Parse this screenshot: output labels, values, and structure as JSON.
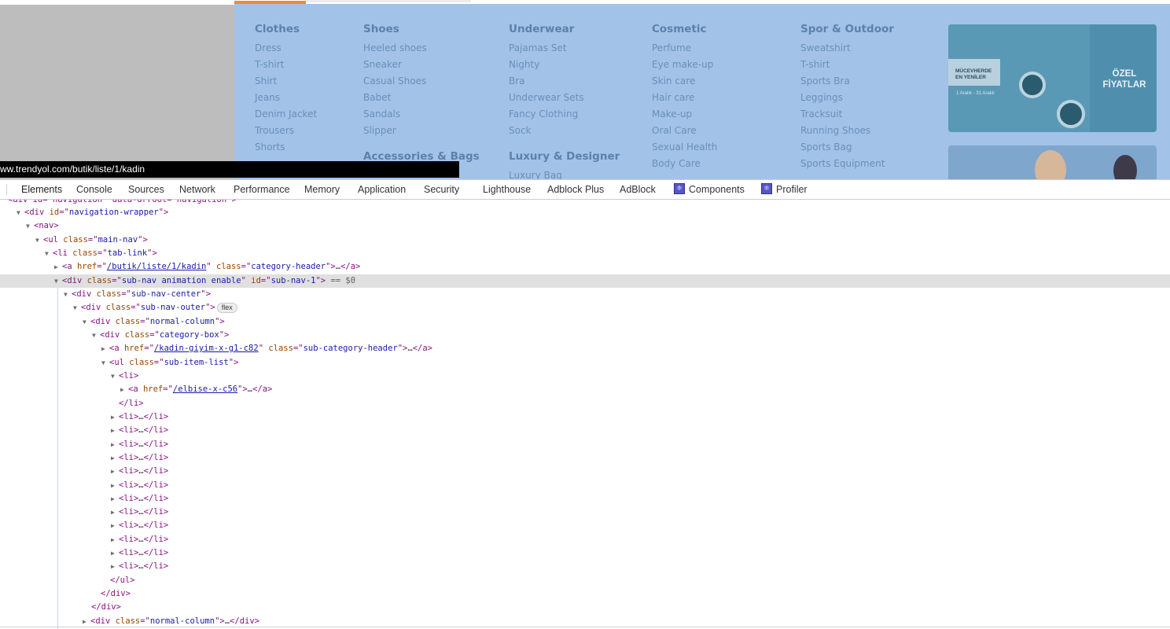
{
  "menu": {
    "columns": [
      {
        "title": "Clothes",
        "items": [
          "Dress",
          "T-shirt",
          "Shirt",
          "Jeans",
          "Denim Jacket",
          "Trousers",
          "Shorts"
        ]
      },
      {
        "title": "Shoes",
        "items": [
          "Heeled shoes",
          "Sneaker",
          "Casual Shoes",
          "Babet",
          "Sandals",
          "Slipper"
        ],
        "second_title": "Accessories & Bags"
      },
      {
        "title": "Underwear",
        "items": [
          "Pajamas Set",
          "Nighty",
          "Bra",
          "Underwear Sets",
          "Fancy Clothing",
          "Sock"
        ],
        "second_title": "Luxury & Designer",
        "second_items": [
          "Luxury Bag"
        ]
      },
      {
        "title": "Cosmetic",
        "items": [
          "Perfume",
          "Eye make-up",
          "Skin care",
          "Hair care",
          "Make-up",
          "Oral Care",
          "Sexual Health",
          "Body Care"
        ]
      },
      {
        "title": "Spor & Outdoor",
        "items": [
          "Sweatshirt",
          "T-shirt",
          "Sports Bra",
          "Leggings",
          "Tracksuit",
          "Running Shoes",
          "Sports Bag",
          "Sports Equipment"
        ]
      }
    ],
    "promo": {
      "left_line1": "MÜCEVHERDE",
      "left_line2": "EN YENİLER",
      "dates": "1 Aralık - 31 Aralık",
      "right_line1": "ÖZEL",
      "right_line2": "FİYATLAR"
    }
  },
  "status_url": "ww.trendyol.com/butik/liste/1/kadin",
  "devtools": {
    "tabs": [
      "Elements",
      "Console",
      "Sources",
      "Network",
      "Performance",
      "Memory",
      "Application",
      "Security",
      "Lighthouse",
      "Adblock Plus",
      "AdBlock",
      "Components",
      "Profiler"
    ],
    "active_tab": "Elements"
  },
  "dom": {
    "clipped_row": "<div id=\"navigation\" data-drroot=\"navigation\">",
    "wrapper_id": "navigation-wrapper",
    "main_nav_class": "main-nav",
    "tab_link_class": "tab-link",
    "category_href": "/butik/liste/1/kadin",
    "category_class": "category-header",
    "selected_class": "sub-nav animation enable",
    "selected_id": "sub-nav-1",
    "selected_suffix": "== $0",
    "sub_nav_center": "sub-nav-center",
    "sub_nav_outer": "sub-nav-outer",
    "flex_badge": "flex",
    "normal_column": "normal-column",
    "category_box": "category-box",
    "sub_cat_href": "/kadin-giyim-x-g1-c82",
    "sub_cat_class": "sub-category-header",
    "sub_item_list": "sub-item-list",
    "first_li_href": "/elbise-x-c56",
    "collapsed_li_count": 12
  }
}
